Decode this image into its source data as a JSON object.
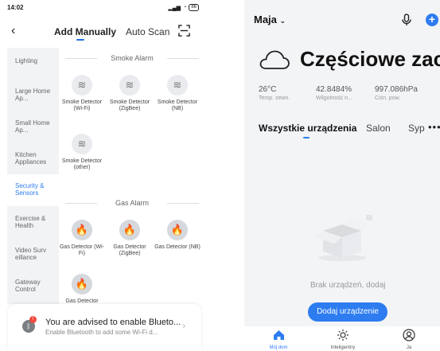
{
  "left": {
    "status": {
      "time": "14:02",
      "battery": "86"
    },
    "nav": {
      "tab_manual": "Add Manually",
      "tab_auto": "Auto Scan"
    },
    "sidebar": {
      "items": [
        {
          "label": "Lighting"
        },
        {
          "label": "Large Home Ap..."
        },
        {
          "label": "Small Home Ap..."
        },
        {
          "label": "Kitchen Appliances"
        },
        {
          "label": "Security & Sensors"
        },
        {
          "label": "Exercise & Health"
        },
        {
          "label": "Video Surv eillance"
        },
        {
          "label": "Gateway Control"
        }
      ],
      "active_index": 4
    },
    "sections": [
      {
        "title": "Smoke Alarm",
        "devices": [
          {
            "label": "Smoke Detector (Wi-Fi)"
          },
          {
            "label": "Smoke Detector (ZigBee)"
          },
          {
            "label": "Smoke Detector (NB)"
          },
          {
            "label": "Smoke Detector (other)"
          }
        ]
      },
      {
        "title": "Gas Alarm",
        "devices": [
          {
            "label": "Gas Detector (Wi-Fi)"
          },
          {
            "label": "Gas Detector (ZigBee)"
          },
          {
            "label": "Gas Detector (NB)"
          },
          {
            "label": "Gas Detector"
          }
        ]
      }
    ],
    "bluetooth_banner": {
      "badge": "!",
      "title": "You are advised to enable Blueto...",
      "subtitle": "Enable Bluetooth to add some Wi-Fi d..."
    }
  },
  "right": {
    "home_name": "Maja",
    "weather": {
      "title": "Częściowe zac...",
      "stats": [
        {
          "value": "26°C",
          "label": "Temp. zewn."
        },
        {
          "value": "42.8484%",
          "label": "Wilgotność n..."
        },
        {
          "value": "997.086hPa",
          "label": "Ciśn. pow."
        }
      ]
    },
    "rooms": [
      {
        "label": "Wszystkie urządzenia"
      },
      {
        "label": "Salon"
      },
      {
        "label": "Syp"
      }
    ],
    "empty_text": "Brak urządzeń, dodaj",
    "add_device_label": "Dodaj urządzenie",
    "tabbar": [
      {
        "label": "Mój dom"
      },
      {
        "label": "Inteligentny"
      },
      {
        "label": "Ja"
      }
    ],
    "accent_color": "#2d7cf0"
  }
}
